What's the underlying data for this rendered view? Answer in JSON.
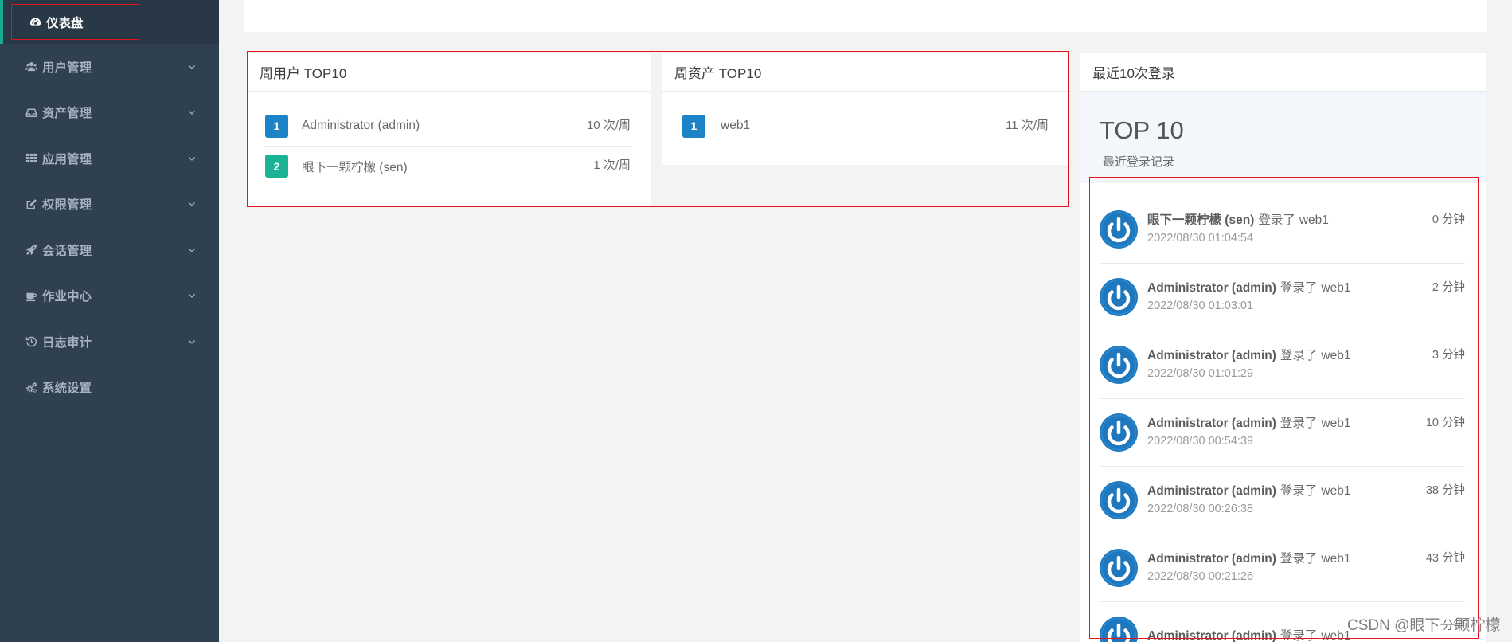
{
  "colors": {
    "sidebar_bg": "#2f4050",
    "sidebar_active_bg": "#293846",
    "accent": "#19aa8d",
    "badge_blue": "#1c84c6",
    "badge_green": "#1ab394",
    "avatar_blue": "#1f78bd",
    "highlight_red": "#e3141b"
  },
  "sidebar": {
    "items": [
      {
        "label": "仪表盘",
        "icon": "dashboard-icon",
        "active": true,
        "has_submenu": false
      },
      {
        "label": "用户管理",
        "icon": "users-icon",
        "has_submenu": true
      },
      {
        "label": "资产管理",
        "icon": "inbox-icon",
        "has_submenu": true
      },
      {
        "label": "应用管理",
        "icon": "grid-icon",
        "has_submenu": true
      },
      {
        "label": "权限管理",
        "icon": "edit-icon",
        "has_submenu": true
      },
      {
        "label": "会话管理",
        "icon": "rocket-icon",
        "has_submenu": true
      },
      {
        "label": "作业中心",
        "icon": "coffee-icon",
        "has_submenu": true
      },
      {
        "label": "日志审计",
        "icon": "history-icon",
        "has_submenu": true
      },
      {
        "label": "系统设置",
        "icon": "cogs-icon",
        "has_submenu": false
      }
    ]
  },
  "weekly_users": {
    "title": "周用户 TOP10",
    "rows": [
      {
        "rank": "1",
        "name": "Administrator (admin)",
        "count": "10 次/周",
        "badge_color": "#1c84c6"
      },
      {
        "rank": "2",
        "name": "眼下一颗柠檬 (sen)",
        "count": "1 次/周",
        "badge_color": "#1ab394"
      }
    ]
  },
  "weekly_assets": {
    "title": "周资产 TOP10",
    "rows": [
      {
        "rank": "1",
        "name": "web1",
        "count": "11 次/周",
        "badge_color": "#1c84c6"
      }
    ]
  },
  "recent_logins": {
    "title": "最近10次登录",
    "heading": "TOP 10",
    "subheading": "最近登录记录",
    "avatar_icon": "power-icon",
    "items": [
      {
        "user": "眼下一颗柠檬 (sen)",
        "action": "登录了",
        "target": "web1",
        "time": "2022/08/30 01:04:54",
        "ago": "0 分钟"
      },
      {
        "user": "Administrator (admin)",
        "action": "登录了",
        "target": "web1",
        "time": "2022/08/30 01:03:01",
        "ago": "2 分钟"
      },
      {
        "user": "Administrator (admin)",
        "action": "登录了",
        "target": "web1",
        "time": "2022/08/30 01:01:29",
        "ago": "3 分钟"
      },
      {
        "user": "Administrator (admin)",
        "action": "登录了",
        "target": "web1",
        "time": "2022/08/30 00:54:39",
        "ago": "10 分钟"
      },
      {
        "user": "Administrator (admin)",
        "action": "登录了",
        "target": "web1",
        "time": "2022/08/30 00:26:38",
        "ago": "38 分钟"
      },
      {
        "user": "Administrator (admin)",
        "action": "登录了",
        "target": "web1",
        "time": "2022/08/30 00:21:26",
        "ago": "43 分钟"
      },
      {
        "user": "Administrator (admin)",
        "action": "登录了",
        "target": "web1",
        "ago": "分钟"
      }
    ]
  },
  "watermark": "CSDN @眼下一颗柠檬"
}
